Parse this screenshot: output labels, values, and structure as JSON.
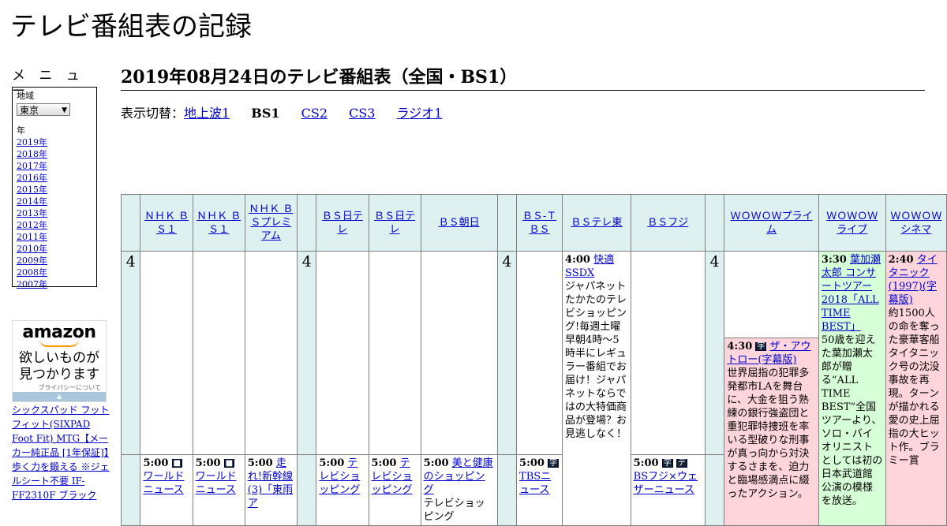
{
  "site_title": "テレビ番組表の記録",
  "menu": {
    "heading": "メ ニ ュ ー",
    "region_label": "地域",
    "region_value": "東京",
    "year_label": "年",
    "years": [
      "2019年",
      "2018年",
      "2017年",
      "2016年",
      "2015年",
      "2014年",
      "2013年",
      "2012年",
      "2011年",
      "2010年",
      "2009年",
      "2008年",
      "2007年"
    ]
  },
  "ad": {
    "logo": "amazon",
    "text_line1": "欲しいものが",
    "text_line2": "見つかります",
    "privacy": "プライバシーについて"
  },
  "product_link": "シックスパッド フットフィット(SIXPAD Foot Fit) MTG【メーカー純正品 [1年保証]】歩く力を鍛える ※ジェルシート不要 IF-FF2310F ブラック",
  "page_title": "2019年08月24日のテレビ番組表（全国・BS1）",
  "switcher": {
    "label": "表示切替：",
    "links": [
      "地上波1",
      "CS2",
      "CS3",
      "ラジオ1"
    ],
    "current": "BS1"
  },
  "channels": [
    "ＮＨＫ ＢＳ１",
    "ＮＨＫ ＢＳ１",
    "ＮＨＫ ＢＳプレミアム",
    "ＢＳ日テレ",
    "ＢＳ日テレ",
    "ＢＳ朝日",
    "ＢＳ-ＴＢＳ",
    "ＢＳテレ東",
    "ＢＳフジ",
    "ＷＯＷＯＷプライム",
    "ＷＯＷＯＷライブ",
    "ＷＯＷＯＷシネマ"
  ],
  "hour_label": "4",
  "programs": {
    "bstelet": {
      "time": "4:00",
      "title": "快適SSDX",
      "desc": "ジャパネットたかたのテレビショッピング!毎週土曜早朝4時～5時半にレギュラー番組でお届け！ジャパネットならではの大特価商品が登場？お見逃しなく！"
    },
    "wowow_prime": {
      "time": "4:30",
      "title": "ザ・アウトロー(字幕版)",
      "desc": "世界屈指の犯罪多発都市LAを舞台に、大金を狙う熟練の銀行強盗団と重犯罪特捜班を率いる型破りな刑事が真っ向から対決するさまを、迫力と臨場感満点に綴ったアクション。"
    },
    "wowow_live": {
      "time": "3:30",
      "title": "葉加瀬太郎 コンサートツアー2018「ALL TIME BEST」",
      "desc": "50歳を迎えた葉加瀬太郎が贈る“ALL TIME BEST”全国ツアーより、ソロ・バイオリニストとしては初の日本武道館公演の模様を放送。"
    },
    "wowow_cinema": {
      "time": "2:40",
      "title": "タイタニック(1997)(字幕版)",
      "desc": "約1500人の命を奪った豪華客船タイタニック号の沈没事故を再現。ターンが描かれる愛の史上屈指の大ヒット作。ブラミー賞"
    },
    "nhkbs1_a": {
      "time": "5:00",
      "title": "ワールドニュース"
    },
    "nhkbs1_b": {
      "time": "5:00",
      "title": "ワールドニュース"
    },
    "nhkbsp": {
      "time": "5:00",
      "title": "走れ!新幹線(3)「東雨ア"
    },
    "bsntv_a": {
      "time": "5:00",
      "title": "テレビショッピング"
    },
    "bsntv_b": {
      "time": "5:00",
      "title": "テレビショッピング"
    },
    "bsasahi": {
      "time": "5:00",
      "title": "美と健康のショッピング",
      "desc": "テレビショッピング"
    },
    "bstbs": {
      "time": "5:00",
      "title": "TBSニュース"
    },
    "bsfuji": {
      "time": "5:00",
      "title": "BSフジ×ウェザーニュース"
    }
  }
}
